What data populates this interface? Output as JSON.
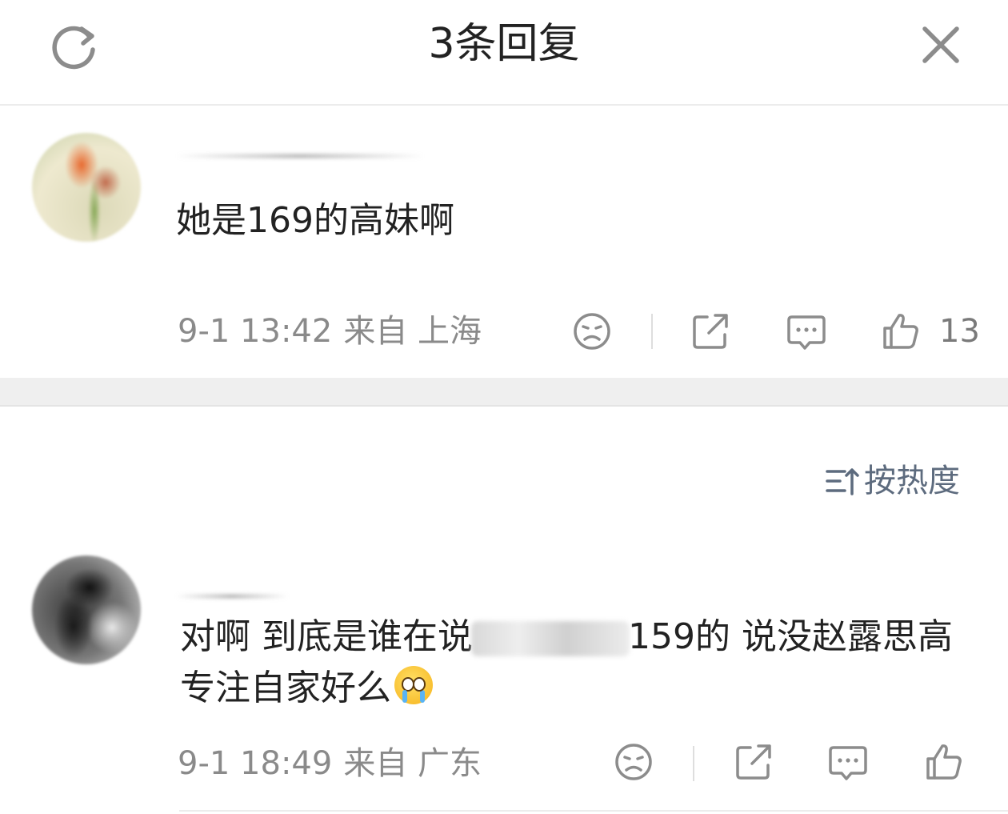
{
  "header": {
    "title": "3条回复",
    "refresh_icon": "refresh-icon",
    "close_icon": "close-icon"
  },
  "reply": {
    "text": "她是169的高妹啊",
    "date": "9-1 13:42",
    "source": "来自 上海",
    "like_count": "13",
    "icons": [
      "dislike-icon",
      "share-icon",
      "comment-icon",
      "like-icon"
    ]
  },
  "sort": {
    "label": "按热度",
    "icon": "sort-icon"
  },
  "comment": {
    "text_before": "对啊 到底是谁在说",
    "text_after": "159的 说没赵露思高 专注自家好么",
    "emoji": "crying-face-emoji",
    "date": "9-1 18:49",
    "source": "来自 广东",
    "icons": [
      "dislike-icon",
      "share-icon",
      "comment-icon",
      "like-icon"
    ]
  },
  "colors": {
    "text": "#222222",
    "meta": "#8a8a8a",
    "icon": "#8c8c8c",
    "sort": "#5d6b7e",
    "band": "#efefef"
  }
}
